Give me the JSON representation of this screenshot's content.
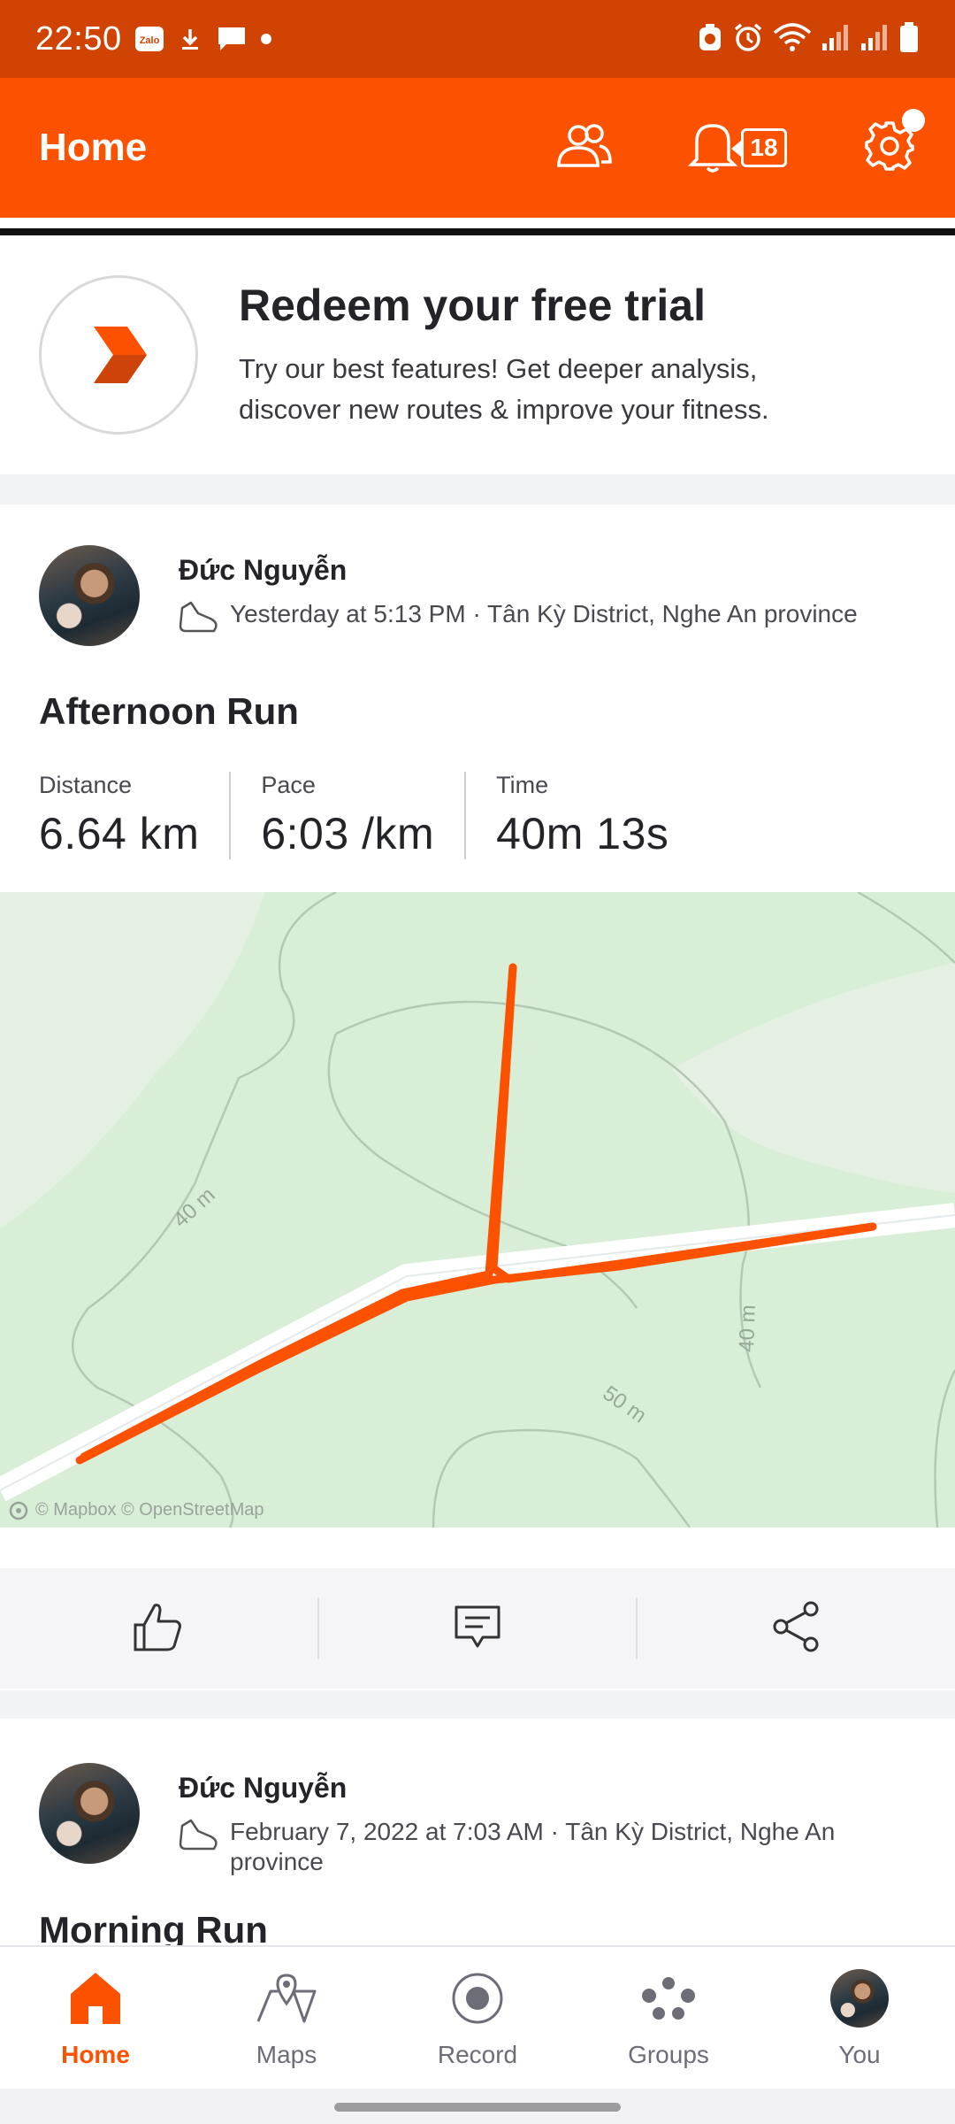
{
  "status_bar": {
    "time": "22:50",
    "app_badge": "Zalo"
  },
  "header": {
    "title": "Home",
    "notification_count": "18"
  },
  "trial_card": {
    "title": "Redeem your free trial",
    "description": "Try our best features! Get deeper analysis, discover new routes & improve your fitness."
  },
  "activity": {
    "athlete_name": "Đức Nguyễn",
    "meta": "Yesterday at 5:13 PM · Tân Kỳ District, Nghe An province",
    "title": "Afternoon Run",
    "stats": [
      {
        "label": "Distance",
        "value": "6.64 km"
      },
      {
        "label": "Pace",
        "value": "6:03 /km"
      },
      {
        "label": "Time",
        "value": "40m 13s"
      }
    ],
    "map": {
      "contour_labels": [
        "40 m",
        "40 m",
        "50 m"
      ],
      "attribution": "© Mapbox © OpenStreetMap",
      "route_color": "#fc5200"
    }
  },
  "activity2": {
    "athlete_name": "Đức Nguyễn",
    "meta": "February 7, 2022 at 7:03 AM · Tân Kỳ District, Nghe An province",
    "title": "Morning Run"
  },
  "bottom_nav": {
    "items": [
      {
        "label": "Home",
        "icon": "home-icon",
        "active": true
      },
      {
        "label": "Maps",
        "icon": "map-icon",
        "active": false
      },
      {
        "label": "Record",
        "icon": "record-icon",
        "active": false
      },
      {
        "label": "Groups",
        "icon": "groups-icon",
        "active": false
      },
      {
        "label": "You",
        "icon": "avatar",
        "active": false
      }
    ]
  },
  "colors": {
    "brand": "#fc5200",
    "status_bar": "#d04302"
  }
}
